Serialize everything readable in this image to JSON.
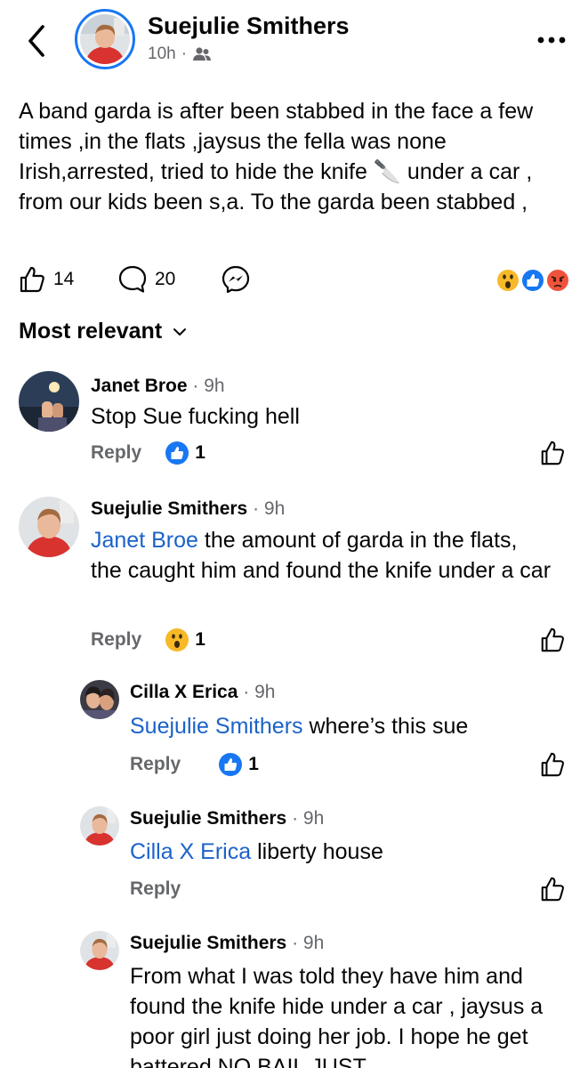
{
  "header": {
    "poster_name": "Suejulie Smithers",
    "time": "10h",
    "separator": "·",
    "audience_icon": "friends-icon",
    "back_icon": "chevron-left-icon",
    "more_icon": "more-dots-icon"
  },
  "post": {
    "text_before_knife": "A band garda is after been stabbed in the face a few times ,in the flats ,jaysus the fella was none Irish,arrested, tried to hide the knife ",
    "knife_emoji": "🔪",
    "text_after_knife": " under a car , from our kids been s,a. To the garda been stabbed ,",
    "likes": "14",
    "comments": "20",
    "reactions": [
      "wow",
      "like",
      "angry"
    ]
  },
  "sort": {
    "label": "Most relevant"
  },
  "comments": [
    {
      "name": "Janet Broe",
      "time": "· 9h",
      "text": "Stop Sue fucking hell",
      "reply_label": "Reply",
      "reaction": "like",
      "reaction_count": "1"
    },
    {
      "name": "Suejulie Smithers",
      "time": "· 9h",
      "mention": "Janet Broe",
      "text": "  the amount of garda in the flats, the caught him and found the knife under a car",
      "reply_label": "Reply",
      "reaction": "wow",
      "reaction_count": "1"
    },
    {
      "name": "Cilla X Erica",
      "time": "· 9h",
      "mention": "Suejulie Smithers",
      "text": " where’s this sue",
      "reply_label": "Reply",
      "reaction": "like",
      "reaction_count": "1"
    },
    {
      "name": "Suejulie Smithers",
      "time": "· 9h",
      "mention": "Cilla X Erica",
      "text": " liberty house",
      "reply_label": "Reply"
    },
    {
      "name": "Suejulie Smithers",
      "time": "· 9h",
      "text": "From what I  was told they have him and found the knife hide under a car , jaysus a poor girl just doing her job. I hope he get battered NO BAIL JUST"
    }
  ],
  "colors": {
    "accent": "#1877f2",
    "mention": "#1b62c9",
    "secondary_text": "#65676b",
    "wow": "#f7b928",
    "angry": "#f0533c"
  }
}
